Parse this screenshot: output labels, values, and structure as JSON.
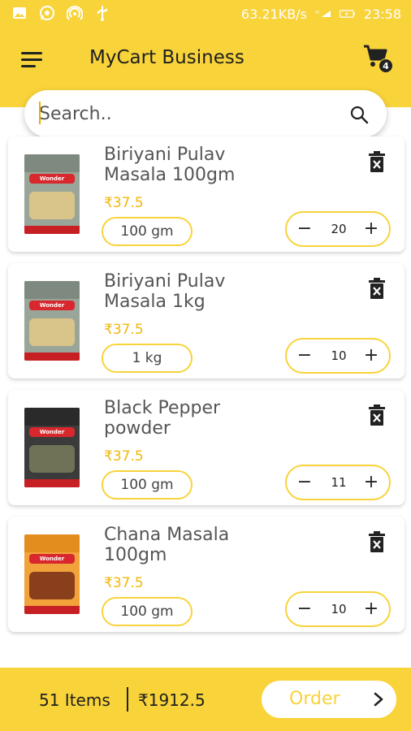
{
  "status_bar": {
    "network_speed": "63.21KB/s",
    "time": "23:58"
  },
  "app_bar": {
    "title": "MyCart Business",
    "cart_count": "4"
  },
  "search": {
    "placeholder": "Search.."
  },
  "cart_items": [
    {
      "name": "Biriyani Pulav Masala 100gm",
      "price": "₹37.5",
      "unit": "100 gm",
      "quantity": "20",
      "pack_colors": {
        "body": "#9aa59a",
        "lid": "#7e8a80",
        "food": "#d9c489"
      }
    },
    {
      "name": "Biriyani Pulav Masala 1kg",
      "price": "₹37.5",
      "unit": "1 kg",
      "quantity": "10",
      "pack_colors": {
        "body": "#9aa59a",
        "lid": "#7e8a80",
        "food": "#d9c489"
      }
    },
    {
      "name": "Black Pepper powder",
      "price": "₹37.5",
      "unit": "100 gm",
      "quantity": "11",
      "pack_colors": {
        "body": "#3b3b3b",
        "lid": "#2a2a2a",
        "food": "#6f7256"
      }
    },
    {
      "name": "Chana Masala 100gm",
      "price": "₹37.5",
      "unit": "100 gm",
      "quantity": "10",
      "pack_colors": {
        "body": "#f2a23a",
        "lid": "#e38d1f",
        "food": "#8a3f1c"
      }
    }
  ],
  "footer": {
    "items_count": "51 Items",
    "total": "₹1912.5",
    "order_label": "Order"
  },
  "colors": {
    "accent": "#f8d33a",
    "price": "#f2b705"
  },
  "icons": [
    "image-icon",
    "whatsapp-icon",
    "hotspot-icon",
    "usb-icon",
    "signal-icon",
    "battery-icon",
    "menu-icon",
    "cart-icon",
    "search-icon",
    "trash-icon",
    "chevron-right-icon"
  ]
}
